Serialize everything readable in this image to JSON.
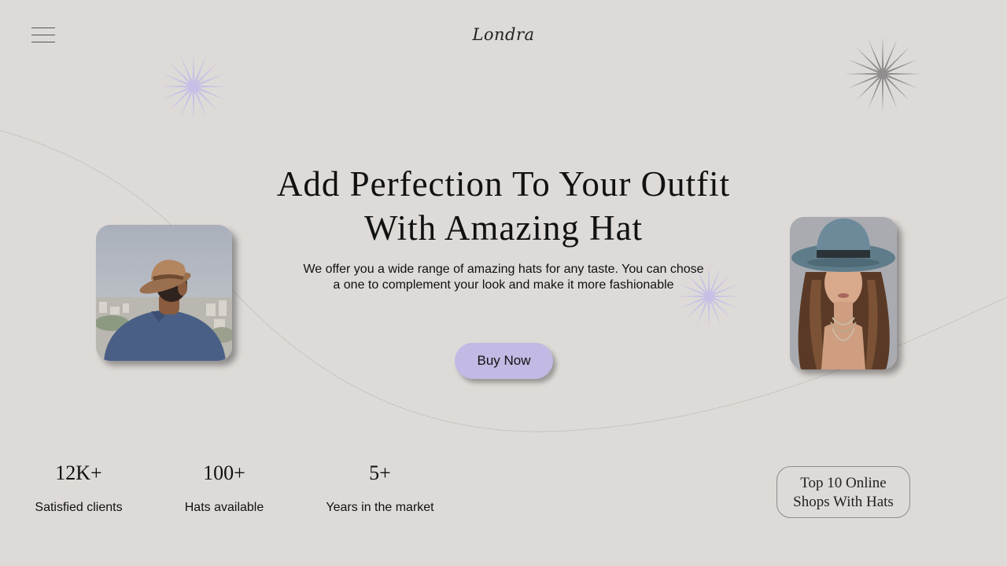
{
  "brand": {
    "logo": "Londra"
  },
  "nav": {
    "menu_icon": "hamburger-menu-icon"
  },
  "hero": {
    "title_line1": "Add Perfection To Your Outfit",
    "title_line2": "With Amazing Hat",
    "description_line1": "We offer you a wide range of amazing hats for any taste. You can chose",
    "description_line2": "a one to complement your look and make it more fashionable",
    "cta_label": "Buy Now"
  },
  "images": {
    "left": "man-in-hat-photo",
    "right": "woman-in-hat-photo"
  },
  "stats": [
    {
      "value": "12K+",
      "label": "Satisfied clients"
    },
    {
      "value": "100+",
      "label": "Hats available"
    },
    {
      "value": "5+",
      "label": "Years in the market"
    }
  ],
  "badge": {
    "line1": "Top 10 Online",
    "line2": "Shops With Hats"
  },
  "colors": {
    "background": "#dedad7",
    "accent_lavender": "#c3b9e4",
    "star_gray": "#8f8d8d",
    "text": "#111111"
  }
}
